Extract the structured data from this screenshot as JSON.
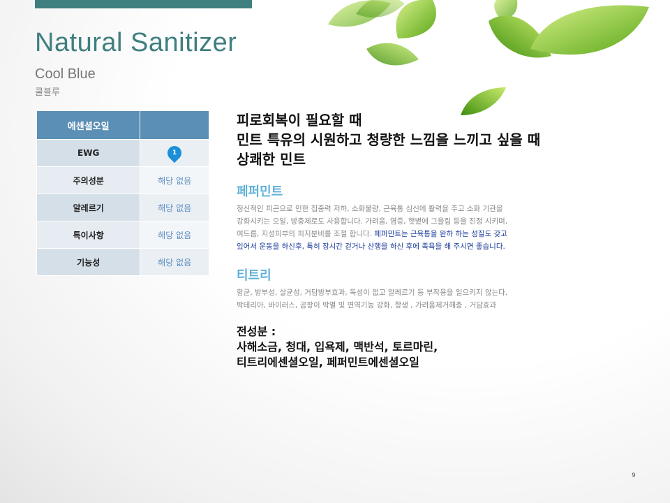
{
  "header": {
    "title": "Natural Sanitizer",
    "subtitle_en": "Cool Blue",
    "subtitle_ko": "쿨블루"
  },
  "info_table": {
    "header": "에센셜오일",
    "rows": [
      {
        "label": "EWG",
        "value": "1"
      },
      {
        "label": "주의성분",
        "value": "해당 없음"
      },
      {
        "label": "알레르기",
        "value": "해당 없음"
      },
      {
        "label": "특이사항",
        "value": "해당 없음"
      },
      {
        "label": "기능성",
        "value": "해당 없음"
      }
    ]
  },
  "headline": {
    "line1": "피로회복이 필요할 때",
    "line2": "민트 특유의 시원하고 청량한 느낌을 느끼고 싶을 때",
    "line3": "상쾌한 민트"
  },
  "sections": [
    {
      "title": "페퍼민트",
      "body_lines": [
        "정신적인 피곤으로 인한 집중력 저하, 소화불량, 근육통 심신에 활력을 주고 소화 기관을",
        "강화시키는 오일, 방충제로도 사용합니다. 가려움, 염증, 햇볕에 그을림 등을 진정 시키며,",
        "여드름, 지성피부의 피지분비를 조절 합니다."
      ],
      "highlight_part1": "페퍼민트는 근육통을 완하 하는 성질도 갖고",
      "highlight_part2": "있어서 운동을 하신후, 특히 장시간 걷거나 산행을 하신 후에 족욕을 해 주시면 좋습니다."
    },
    {
      "title": "티트리",
      "body_lines": [
        "항균, 방부성, 살균성, 거담방부효과,  독성이 없고 알레르기 등 부작용을 일으키지 않는다.",
        "박테리아, 바이러스, 곰팡이 박멸 및 면역기능 강화, 항생 , 가려움제거해충  , 거담효과"
      ]
    }
  ],
  "ingredients": {
    "label": "전성분 :",
    "line1": "사해소금, 청대,  입욕제,  맥반석,  토르마린,",
    "line2": "티트리에센셜오일, 페퍼민트에센셜오일"
  },
  "page_number": "9",
  "colors": {
    "accent": "#3f7f80",
    "table_header": "#5b8fb5",
    "section_title": "#5fb1d9",
    "highlight_text": "#1a3a9a",
    "ewg_badge": "#1a8fd8",
    "leaf_green": "#7cc423"
  }
}
